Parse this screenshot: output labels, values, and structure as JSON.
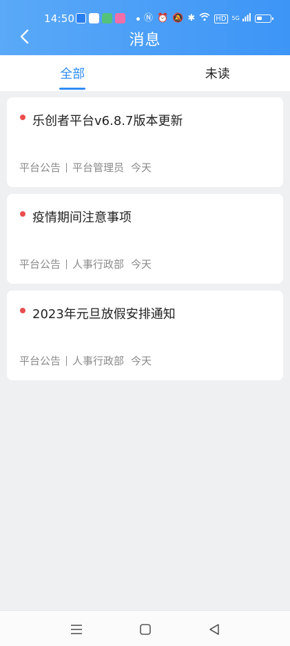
{
  "status_bar": {
    "time": "14:50",
    "network": "5G"
  },
  "header": {
    "title": "消息"
  },
  "tabs": [
    {
      "label": "全部",
      "active": true
    },
    {
      "label": "未读",
      "active": false
    }
  ],
  "messages": [
    {
      "title": "乐创者平台v6.8.7版本更新",
      "category": "平台公告",
      "sender": "平台管理员",
      "date": "今天",
      "unread": true
    },
    {
      "title": "疫情期间注意事项",
      "category": "平台公告",
      "sender": "人事行政部",
      "date": "今天",
      "unread": true
    },
    {
      "title": "2023年元旦放假安排通知",
      "category": "平台公告",
      "sender": "人事行政部",
      "date": "今天",
      "unread": true
    }
  ],
  "nav_bar": {
    "items": [
      "menu-icon",
      "home-square-icon",
      "back-triangle-icon"
    ]
  },
  "colors": {
    "header": "#3d95f6",
    "accent": "#2f8cf3",
    "unread_dot": "#e94d4d",
    "background": "#eff0f2"
  }
}
